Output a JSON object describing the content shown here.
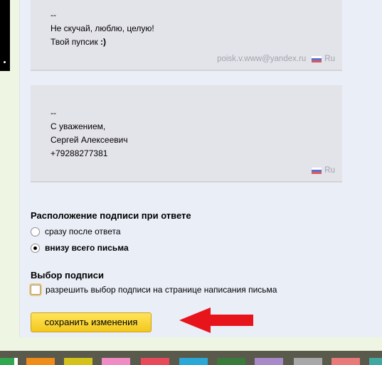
{
  "signatures": [
    {
      "lines": [
        {
          "text": "--",
          "bold": ""
        },
        {
          "text": "Не скучай, люблю, целую!",
          "bold": ""
        },
        {
          "text": "Твой пупсик ",
          "bold": ":)"
        }
      ],
      "email": "poisk.v.www@yandex.ru",
      "lang": "Ru"
    },
    {
      "lines": [
        {
          "text": "--",
          "bold": ""
        },
        {
          "text": "С уважением,",
          "bold": ""
        },
        {
          "text": "Сергей Алексеевич",
          "bold": ""
        },
        {
          "text": "+79288277381",
          "bold": ""
        }
      ],
      "email": "",
      "lang": "Ru"
    }
  ],
  "placement": {
    "title": "Расположение подписи при ответе",
    "options": [
      {
        "label": "сразу после ответа",
        "selected": false
      },
      {
        "label": "внизу всего письма",
        "selected": true
      }
    ]
  },
  "choice": {
    "title": "Выбор подписи",
    "checkbox_label": "разрешить выбор подписи на странице написания письма",
    "checked": false
  },
  "save_button": "сохранить изменения",
  "colors": {
    "panel": "#eaeef7",
    "card": "#e3e3ea",
    "button": "#f7d33a",
    "arrow": "#e8141c"
  },
  "theme_tiles": [
    "#2fa84f",
    "#f08c1a",
    "#d4c21a",
    "#f08cc4",
    "#e84a5a",
    "#2aa8d8",
    "#3a7a3a",
    "#e03a2a",
    "#a88ac8",
    "#a8a8a8",
    "#e87a7a",
    "#40a8a0"
  ]
}
